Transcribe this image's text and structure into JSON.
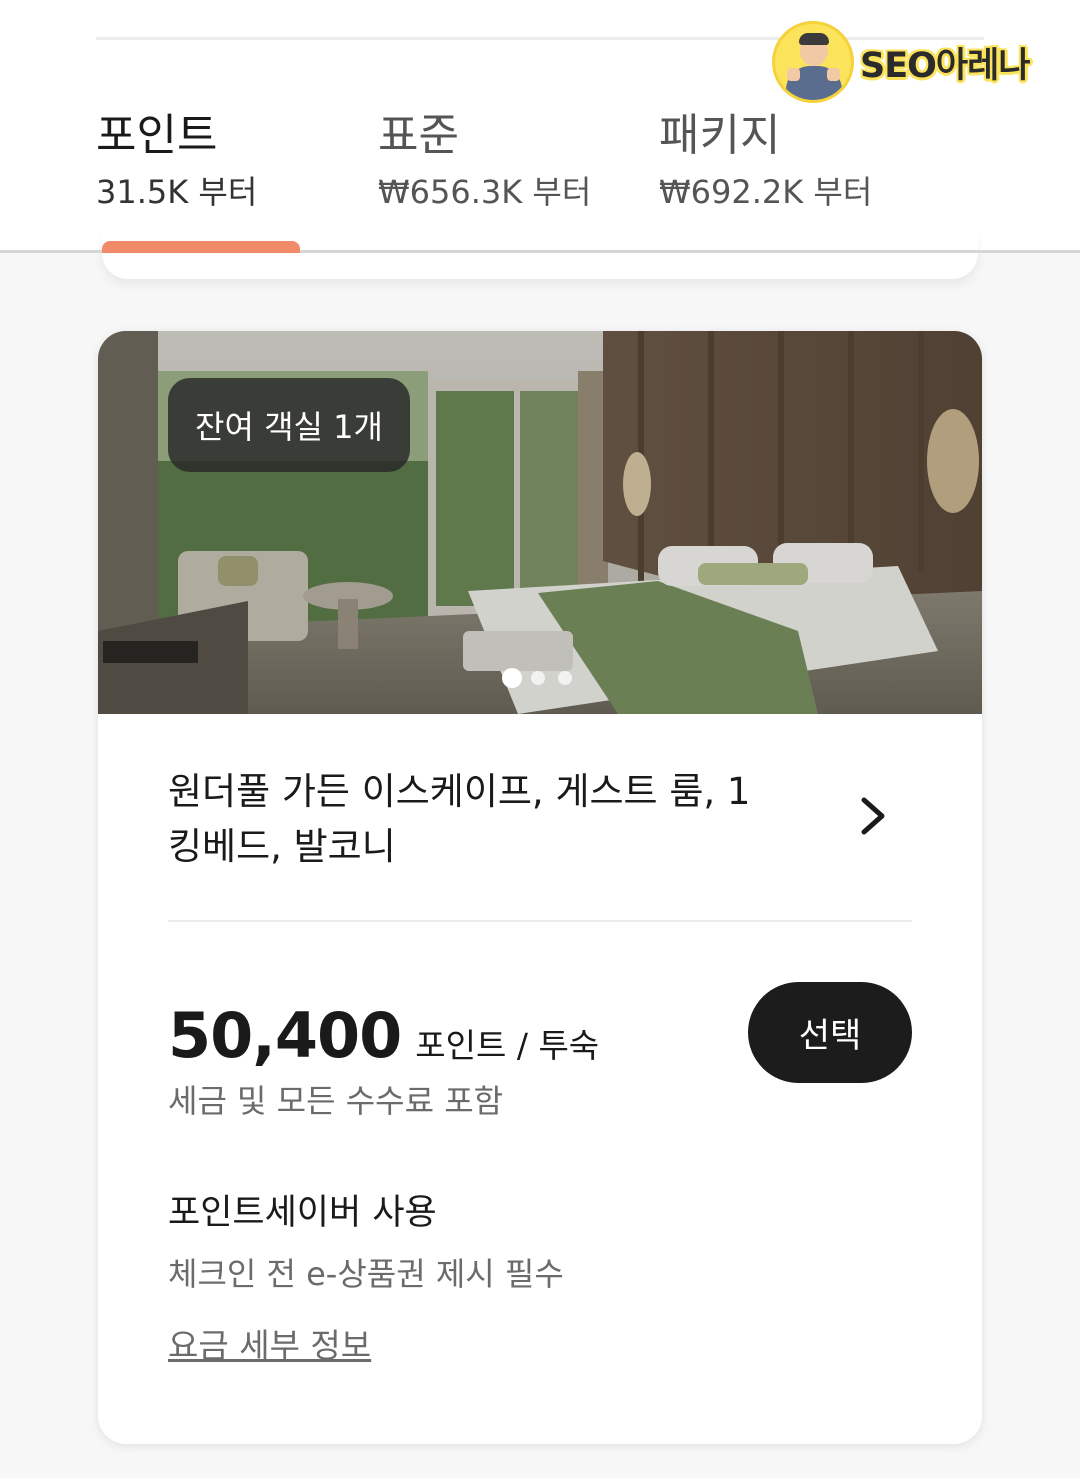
{
  "watermark": {
    "text": "SEO아레나"
  },
  "tabs": [
    {
      "title": "포인트",
      "price": "31.5K 부터",
      "active": true
    },
    {
      "title": "표준",
      "price": "₩656.3K 부터",
      "active": false
    },
    {
      "title": "패키지",
      "price": "₩692.2K 부터",
      "active": false
    }
  ],
  "accent_color": "#f08a69",
  "room": {
    "availability": "잔여 객실 1개",
    "photo_pages": 3,
    "photo_current": 1,
    "title_line1": "원더풀 가든 이스케이프, 게스트 룸, 1",
    "title_line2": "킹베드, 발코니",
    "price_value": "50,400",
    "price_unit": "포인트 / 투숙",
    "tax_note": "세금 및 모든 수수료 포함",
    "select_label": "선택",
    "pointsaver_title": "포인트세이버 사용",
    "pointsaver_note": "체크인 전 e-상품권 제시 필수",
    "rate_details_link": "요금 세부 정보"
  }
}
